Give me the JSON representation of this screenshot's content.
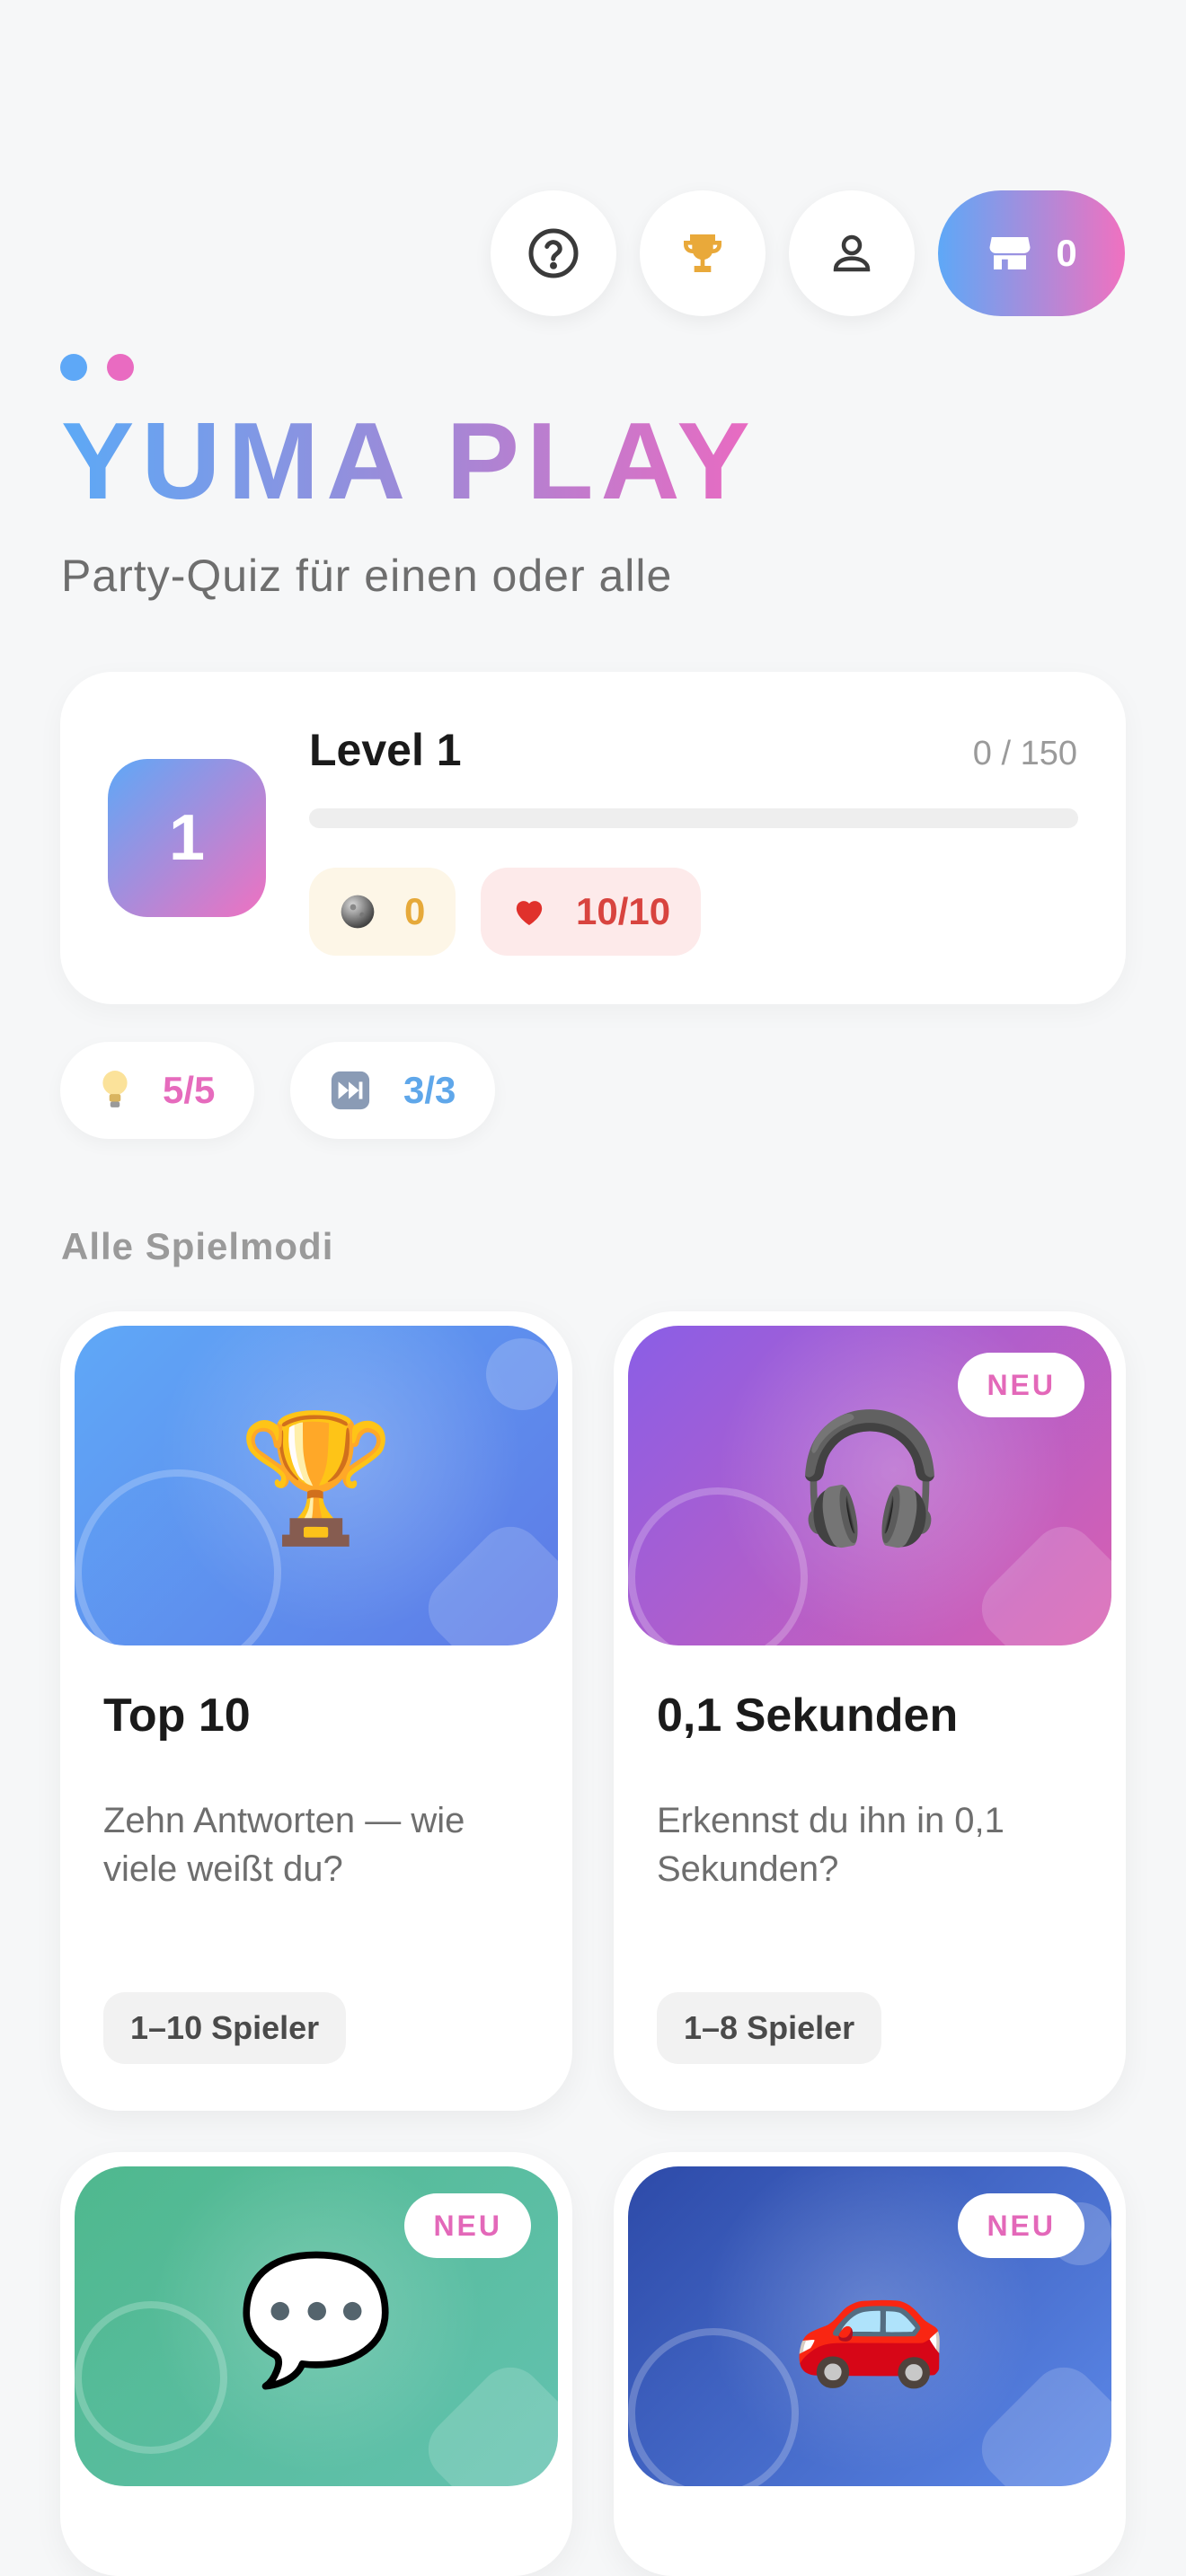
{
  "header": {
    "shop_count": "0",
    "icons": [
      "help-icon",
      "trophy-icon",
      "profile-icon",
      "shop-icon"
    ]
  },
  "brand": {
    "title": "YUMA PLAY",
    "subtitle": "Party-Quiz für einen oder alle",
    "dot_colors": [
      "#5ea8f7",
      "#e96bc1"
    ]
  },
  "level": {
    "badge": "1",
    "title": "Level 1",
    "xp": "0 / 150",
    "progress_fraction": 0,
    "coins": "0",
    "hearts": "10/10"
  },
  "boosts": {
    "hints": "5/5",
    "skips": "3/3"
  },
  "section_title": "Alle Spielmodi",
  "modes": [
    {
      "title": "Top 10",
      "desc": "Zehn Antworten — wie viele weißt du?",
      "players": "1–10 Spieler",
      "badge": "",
      "emoji": "🏆",
      "gradient": [
        "#5fa8f7",
        "#5e7ae6"
      ]
    },
    {
      "title": "0,1 Sekunden",
      "desc": "Erkennst du ihn in 0,1 Sekunden?",
      "players": "1–8 Spieler",
      "badge": "NEU",
      "emoji": "🎧",
      "gradient": [
        "#8a5ee6",
        "#d95fb0"
      ]
    },
    {
      "title": "",
      "desc": "",
      "players": "",
      "badge": "NEU",
      "emoji": "💬",
      "gradient": [
        "#4fb88e",
        "#63c2b0"
      ]
    },
    {
      "title": "",
      "desc": "",
      "players": "",
      "badge": "NEU",
      "emoji": "🚗",
      "gradient": [
        "#2d4aa8",
        "#5c88e8"
      ]
    }
  ],
  "colors": {
    "accent_blue": "#5ea8f7",
    "accent_pink": "#f071c0",
    "coin": "#e6a93a",
    "heart": "#d8443f"
  }
}
